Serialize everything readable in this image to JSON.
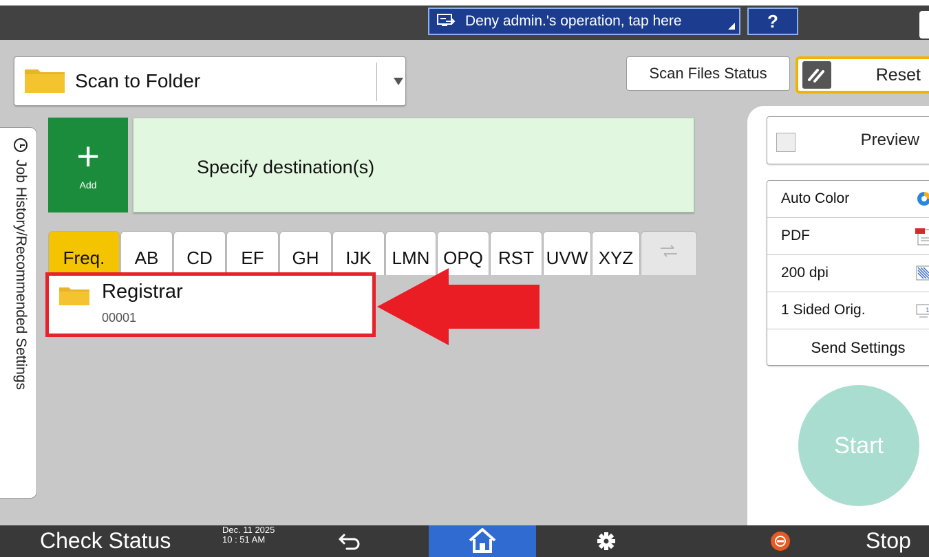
{
  "topbar": {
    "deny_label": "Deny admin.'s operation, tap here",
    "help_label": "?"
  },
  "mode": {
    "current": "Scan to Folder",
    "icon": "folder-icon"
  },
  "toolbar": {
    "scan_files_status": "Scan Files Status",
    "reset": "Reset"
  },
  "side_tab": {
    "label": "Job History/Recommended Settings",
    "icon": "clock-icon"
  },
  "destination": {
    "add_label": "Add",
    "placeholder": "Specify destination(s)"
  },
  "tabs": [
    {
      "label": "Freq.",
      "active": true
    },
    {
      "label": "AB"
    },
    {
      "label": "CD"
    },
    {
      "label": "EF"
    },
    {
      "label": "GH"
    },
    {
      "label": "IJK"
    },
    {
      "label": "LMN"
    },
    {
      "label": "OPQ"
    },
    {
      "label": "RST"
    },
    {
      "label": "UVW"
    },
    {
      "label": "XYZ"
    }
  ],
  "destinations": [
    {
      "name": "Registrar",
      "number": "00001"
    }
  ],
  "right_panel": {
    "preview": "Preview",
    "settings": [
      {
        "label": "Auto Color",
        "icon": "color-mode-icon"
      },
      {
        "label": "PDF",
        "icon": "pdf-file-icon"
      },
      {
        "label": "200 dpi",
        "icon": "resolution-icon"
      },
      {
        "label": "1 Sided Orig.",
        "icon": "one-sided-icon"
      }
    ],
    "send_settings": "Send Settings",
    "start": "Start"
  },
  "bottombar": {
    "check_status": "Check Status",
    "date": "Dec. 11 2025",
    "time": "10 : 51 AM",
    "stop": "Stop"
  },
  "colors": {
    "accent_yellow": "#f5c400",
    "add_green": "#1a8c3c",
    "home_blue": "#2f6bd0",
    "highlight_red": "#e6232a",
    "start_mint": "#a9ddcf"
  }
}
